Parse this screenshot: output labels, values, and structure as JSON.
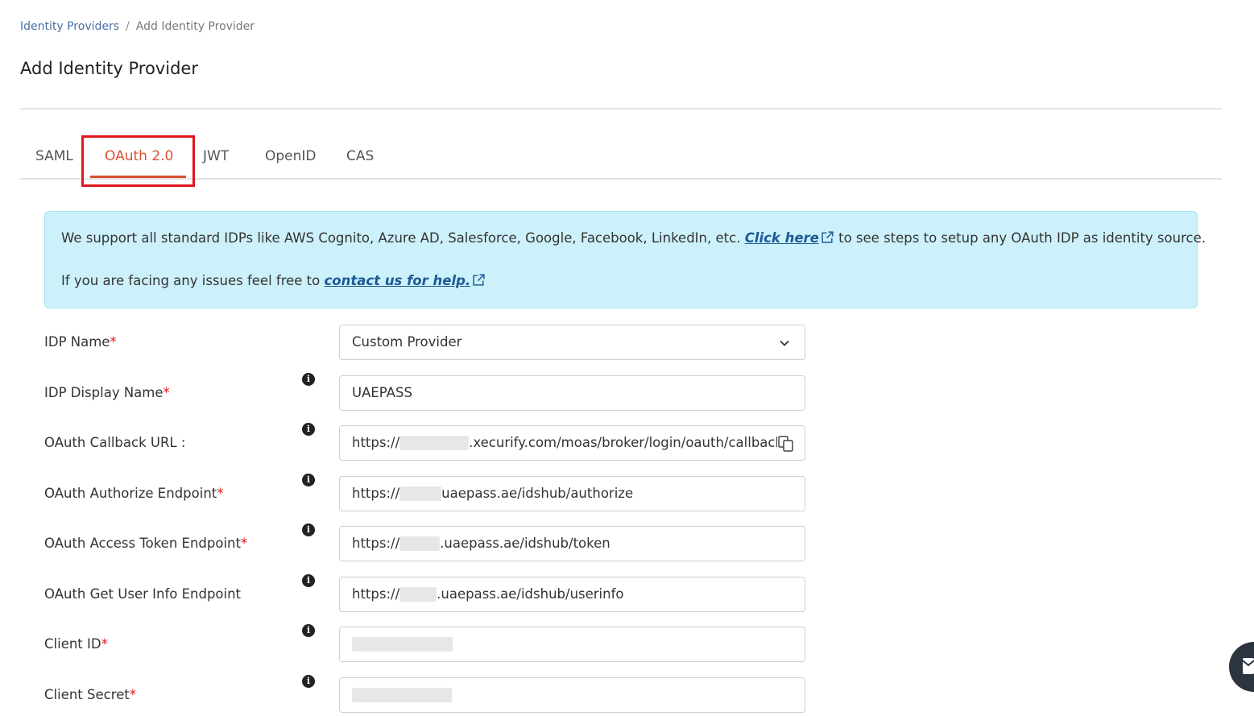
{
  "breadcrumb": {
    "parent": "Identity Providers",
    "separator": "/",
    "current": "Add Identity Provider"
  },
  "page": {
    "title": "Add Identity Provider"
  },
  "tabs": [
    {
      "label": "SAML",
      "active": false
    },
    {
      "label": "OAuth 2.0",
      "active": true
    },
    {
      "label": "JWT",
      "active": false
    },
    {
      "label": "OpenID",
      "active": false
    },
    {
      "label": "CAS",
      "active": false
    }
  ],
  "info_box": {
    "line1_prefix": "We support all standard IDPs like AWS Cognito, Azure AD, Salesforce, Google, Facebook, LinkedIn, etc.",
    "line1_link": "Click here",
    "line1_suffix": "to see steps to setup any OAuth IDP as identity source.",
    "line2_prefix": "If you are facing any issues feel free to",
    "line2_link": "contact us for help."
  },
  "form": {
    "idp_name": {
      "label": "IDP Name",
      "required": "*",
      "value": "Custom Provider"
    },
    "idp_display_name": {
      "label": "IDP Display Name",
      "required": "*",
      "value": "UAEPASS"
    },
    "callback_url": {
      "label": "OAuth Callback URL :",
      "value_prefix": "https://",
      "value_suffix": ".xecurify.com/moas/broker/login/oauth/callback"
    },
    "authorize_endpoint": {
      "label": "OAuth Authorize Endpoint",
      "required": "*",
      "value_prefix": "https://",
      "value_suffix": "uaepass.ae/idshub/authorize"
    },
    "token_endpoint": {
      "label": "OAuth Access Token Endpoint",
      "required": "*",
      "value_prefix": "https://",
      "value_suffix": ".uaepass.ae/idshub/token"
    },
    "userinfo_endpoint": {
      "label": "OAuth Get User Info Endpoint",
      "value_prefix": "https://",
      "value_suffix": ".uaepass.ae/idshub/userinfo"
    },
    "client_id": {
      "label": "Client ID",
      "required": "*"
    },
    "client_secret": {
      "label": "Client Secret",
      "required": "*"
    }
  },
  "icons": {
    "info": "info-icon",
    "external_link": "external-link-icon",
    "dropdown": "chevron-down-icon",
    "copy": "copy-icon",
    "chat": "chat-icon"
  },
  "colors": {
    "accent": "#d9502f",
    "highlight": "#e0161c",
    "info_bg": "#cdf1fa",
    "link": "#1c5a96",
    "required": "#e0161c"
  }
}
